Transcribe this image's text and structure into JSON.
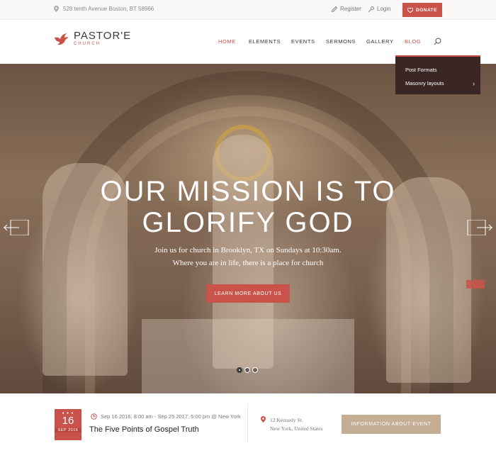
{
  "topbar": {
    "address": "528 tenth Avenue Boston, BT 58966",
    "register": "Register",
    "login": "Login",
    "donate": "DONATE"
  },
  "logo": {
    "name": "PASTOR'E",
    "sub": "CHURCH"
  },
  "nav": {
    "items": [
      "HOME",
      "ELEMENTS",
      "EVENTS",
      "SERMONS",
      "GALLERY",
      "BLOG"
    ],
    "active": "HOME"
  },
  "dropdown": {
    "items": [
      "Post Formats",
      "Masonry layouts"
    ]
  },
  "hero": {
    "title_line1": "OUR MISSION IS TO",
    "title_line2": "GLORIFY GOD",
    "sub_line1": "Join us for church in Brooklyn, TX on Sundays at 10:30am.",
    "sub_line2": "Where you are in life, there is a place for church",
    "button": "LEARN MORE ABOUT US",
    "slides": 3,
    "active_slide": 1
  },
  "event": {
    "day": "16",
    "month": "SEP 2016",
    "datetime": "Sep 16 2016, 8:00 am - Sep 25 2017, 5:00 pm @ New York",
    "title": "The Five Points of Gospel Truth",
    "address_line1": "12 Kennedy St.",
    "address_line2": "New York, United States",
    "button": "INFORMATION ABOUT EVENT"
  },
  "colors": {
    "accent": "#c9534a",
    "tan": "#c5ae94",
    "dropdown_bg": "#3a2624"
  }
}
